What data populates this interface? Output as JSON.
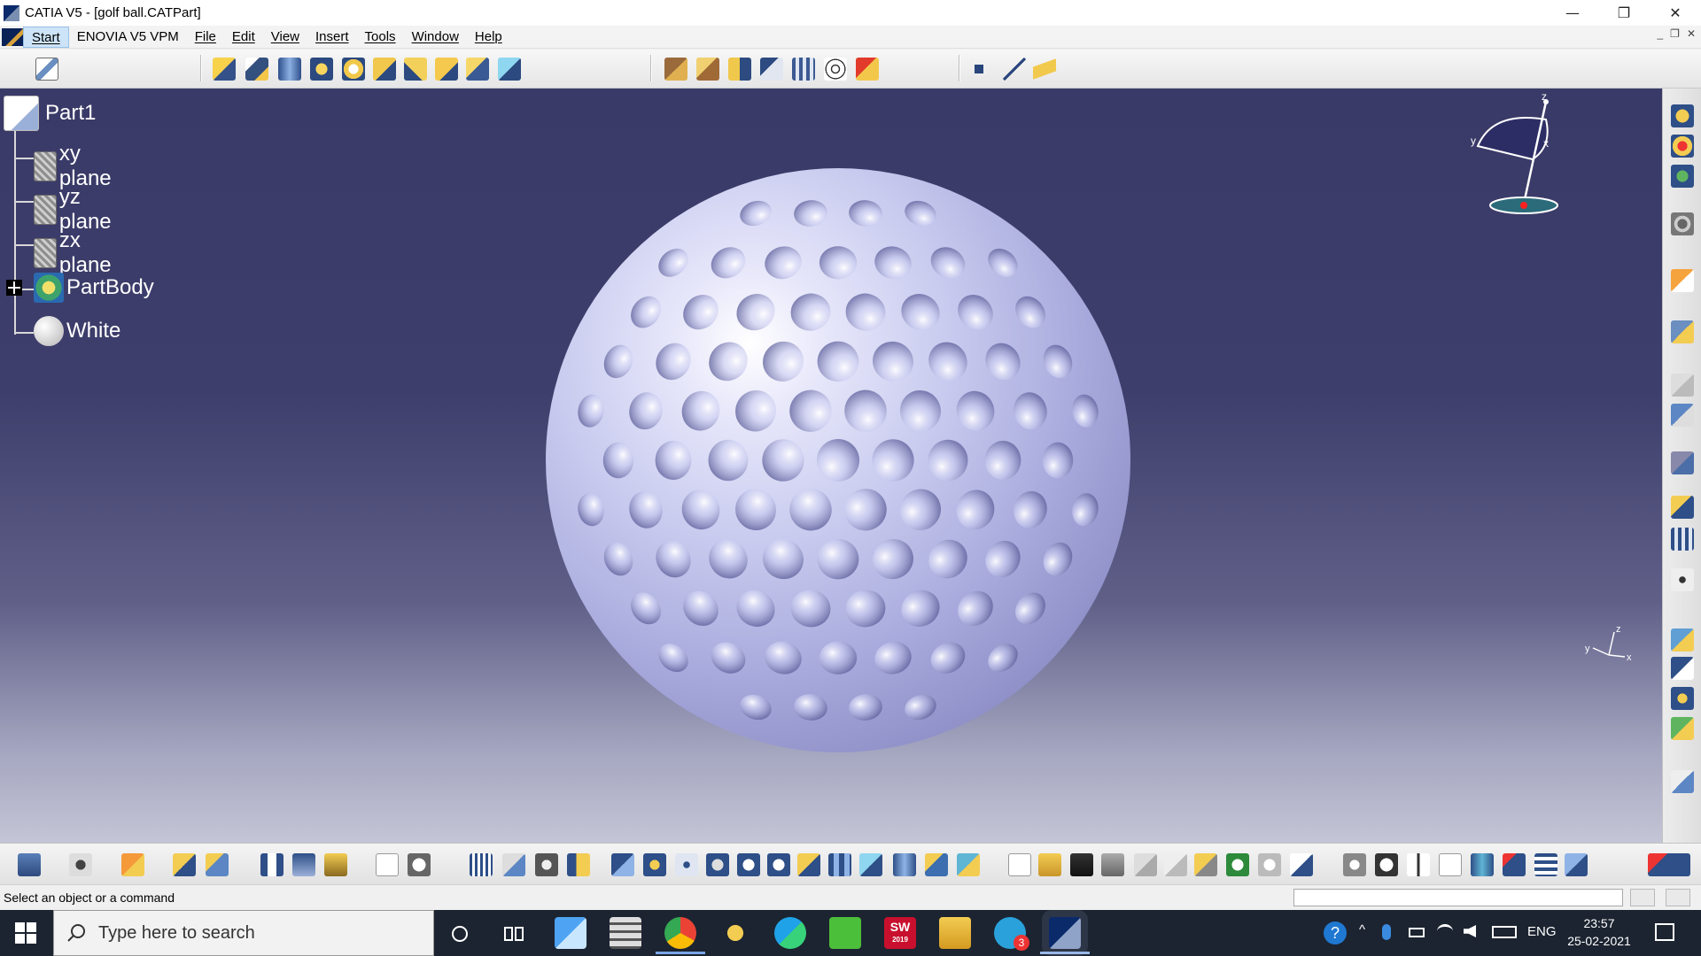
{
  "titlebar": {
    "title": "CATIA V5 - [golf ball.CATPart]",
    "minimize": "—",
    "restore": "❐",
    "close": "✕"
  },
  "menubar": {
    "items": [
      "Start",
      "ENOVIA V5 VPM",
      "File",
      "Edit",
      "View",
      "Insert",
      "Tools",
      "Window",
      "Help"
    ],
    "mdi_min": "_",
    "mdi_restore": "❐",
    "mdi_close": "✕"
  },
  "tree": {
    "root": "Part1",
    "items": [
      "xy plane",
      "yz plane",
      "zx plane",
      "PartBody",
      "White"
    ]
  },
  "compass": {
    "z": "z",
    "y": "y",
    "x": "x"
  },
  "axis_triad": {
    "z": "z",
    "y": "y",
    "x": "x"
  },
  "status": {
    "message": "Select an object or a command"
  },
  "taskbar": {
    "search_placeholder": "Type here to search",
    "lang": "ENG",
    "time": "23:57",
    "date": "25-02-2021",
    "telegram_badge": "3",
    "sw_label": "SW",
    "sw_year": "2019"
  },
  "colors": {
    "viewport_top": "#3a3a68",
    "viewport_bottom": "#c4c5d6",
    "ball_highlight": "#ffffff",
    "ball_shade": "#7d7fb8",
    "taskbar": "#1c2431"
  }
}
